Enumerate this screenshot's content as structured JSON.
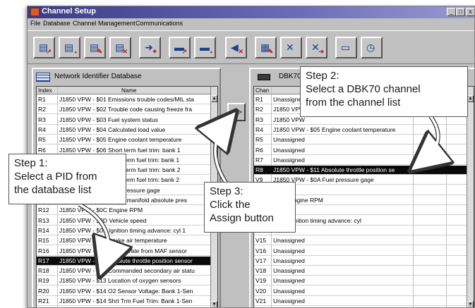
{
  "window": {
    "title": "Channel Setup",
    "controls": [
      "_",
      "□",
      "x"
    ]
  },
  "menu": [
    "File",
    "Database",
    "Channel Management",
    "Communications"
  ],
  "toolbar": {
    "buttons": [
      {
        "icon": "open-db-icon",
        "glyph": "▤",
        "sub": "↗"
      },
      {
        "icon": "save-db-icon",
        "glyph": "▤",
        "sub": "▪"
      },
      {
        "icon": "edit-db-icon",
        "glyph": "▤",
        "sub": "✎"
      },
      {
        "icon": "delete-db-icon",
        "glyph": "▤",
        "sub": "✕"
      },
      {
        "icon": "assign-icon",
        "glyph": "➜",
        "sub": "✦"
      },
      {
        "icon": "open-setup-icon",
        "glyph": "▬",
        "sub": "↗"
      },
      {
        "icon": "save-setup-icon",
        "glyph": "▬",
        "sub": "▪"
      },
      {
        "icon": "unassign-icon",
        "glyph": "◀",
        "sub": "✕"
      },
      {
        "icon": "properties-icon",
        "glyph": "▦",
        "sub": "✎"
      },
      {
        "icon": "clear-icon",
        "glyph": "✕",
        "sub": ""
      },
      {
        "icon": "clear-all-icon",
        "glyph": "✕",
        "sub": "➜"
      },
      {
        "icon": "vehicle-icon",
        "glyph": "▭",
        "sub": ""
      },
      {
        "icon": "timer-icon",
        "glyph": "◷",
        "sub": ""
      }
    ]
  },
  "left_panel": {
    "title": "Network Identifier Database",
    "columns": [
      "Index",
      "Name"
    ],
    "rows": [
      {
        "index": "R1",
        "name": "J1850 VPW - $01 Emissions trouble codes/MIL sta",
        "selected": false
      },
      {
        "index": "R2",
        "name": "J1850 VPW - $02 Trouble code causing freeze fra",
        "selected": false
      },
      {
        "index": "R3",
        "name": "J1850 VPW - $03 Fuel system status",
        "selected": false
      },
      {
        "index": "R4",
        "name": "J1850 VPW - $04 Calculated load value",
        "selected": false
      },
      {
        "index": "R5",
        "name": "J1850 VPW - $05 Engine coolant temperature",
        "selected": false
      },
      {
        "index": "R6",
        "name": "J1850 VPW - $06 Short term fuel trim: bank 1",
        "selected": false
      },
      {
        "index": "R7",
        "name": "J1850 VPW - $07 Long term fuel trim: bank 1",
        "selected": false
      },
      {
        "index": "R8",
        "name": "J1850 VPW - $08 Short term fuel trim: bank 2",
        "selected": false
      },
      {
        "index": "R9",
        "name": "J1850 VPW - $09 Long term fuel trim: bank 2",
        "selected": false
      },
      {
        "index": "R10",
        "name": "J1850 VPW - $0A Fuel pressure gage",
        "selected": false
      },
      {
        "index": "R11",
        "name": "J1850 VPW - $0B Intake manifold absolute pres",
        "selected": false
      },
      {
        "index": "R12",
        "name": "J1850 VPW - $0C Engine RPM",
        "selected": false
      },
      {
        "index": "R13",
        "name": "J1850 VPW - $0D Vehicle speed",
        "selected": false
      },
      {
        "index": "R14",
        "name": "J1850 VPW - $0E Ignition timing advance: cyl 1",
        "selected": false
      },
      {
        "index": "R15",
        "name": "J1850 VPW - $0F Intake air temperature",
        "selected": false
      },
      {
        "index": "R16",
        "name": "J1850 VPW - $10 Air flow rate from MAF sensor",
        "selected": false
      },
      {
        "index": "R17",
        "name": "J1850 VPW - $11 Absolute throttle position sensor",
        "selected": true
      },
      {
        "index": "R18",
        "name": "J1850 VPW - $12 Commanded secondary air statu",
        "selected": false
      },
      {
        "index": "R19",
        "name": "J1850 VPW - $13 Location of oxygen sensors",
        "selected": false
      },
      {
        "index": "R20",
        "name": "J1850 VPW - $14 O2 Sensor Voltage: Bank 1-Sen",
        "selected": false
      },
      {
        "index": "R21",
        "name": "J1850 VPW - $14 Shrt Trm Fuel Trim: Bank 1-Sen",
        "selected": false
      }
    ]
  },
  "assign_button": {
    "label": ">>>"
  },
  "right_panel": {
    "title": "DBK70",
    "columns": [
      "Chan",
      ""
    ],
    "rows": [
      {
        "index": "R1",
        "name": "Unassigned",
        "selected": false
      },
      {
        "index": "R2",
        "name": "J1850 VPW",
        "selected": false
      },
      {
        "index": "R3",
        "name": "J1850 VPW",
        "selected": false
      },
      {
        "index": "R4",
        "name": "J1850 VPW - $05 Engine coolant temperature",
        "selected": false
      },
      {
        "index": "R5",
        "name": "Unassigned",
        "selected": false
      },
      {
        "index": "R6",
        "name": "Unassigned",
        "selected": false
      },
      {
        "index": "R7",
        "name": "Unassigned",
        "selected": false
      },
      {
        "index": "R8",
        "name": "J1850 VPW - $11 Absolute throttle position se",
        "selected": true
      },
      {
        "index": "V9",
        "name": "J1850 VPW - $0A Fuel pressure gage",
        "selected": false
      },
      {
        "index": "",
        "name": "",
        "selected": false
      },
      {
        "index": "",
        "name": "- $0C Engine RPM",
        "selected": false
      },
      {
        "index": "",
        "name": "",
        "selected": false
      },
      {
        "index": "",
        "name": "- $0E Ignition timing advance: cyl",
        "selected": false
      },
      {
        "index": "",
        "name": "",
        "selected": false
      },
      {
        "index": "V15",
        "name": "Unassigned",
        "selected": false
      },
      {
        "index": "V16",
        "name": "Unassigned",
        "selected": false
      },
      {
        "index": "V17",
        "name": "Unassigned",
        "selected": false
      },
      {
        "index": "V18",
        "name": "Unassigned",
        "selected": false
      },
      {
        "index": "V19",
        "name": "Unassigned",
        "selected": false
      },
      {
        "index": "V20",
        "name": "Unassigned",
        "selected": false
      },
      {
        "index": "V21",
        "name": "Unassigned",
        "selected": false
      }
    ]
  },
  "callouts": {
    "step1": [
      "Step 1:",
      "Select a PID from",
      "the database list"
    ],
    "step2": [
      "Step 2:",
      "Select a DBK70 channel",
      "from the channel list"
    ],
    "step3": [
      "Step 3:",
      "Click the",
      "Assign button"
    ]
  }
}
